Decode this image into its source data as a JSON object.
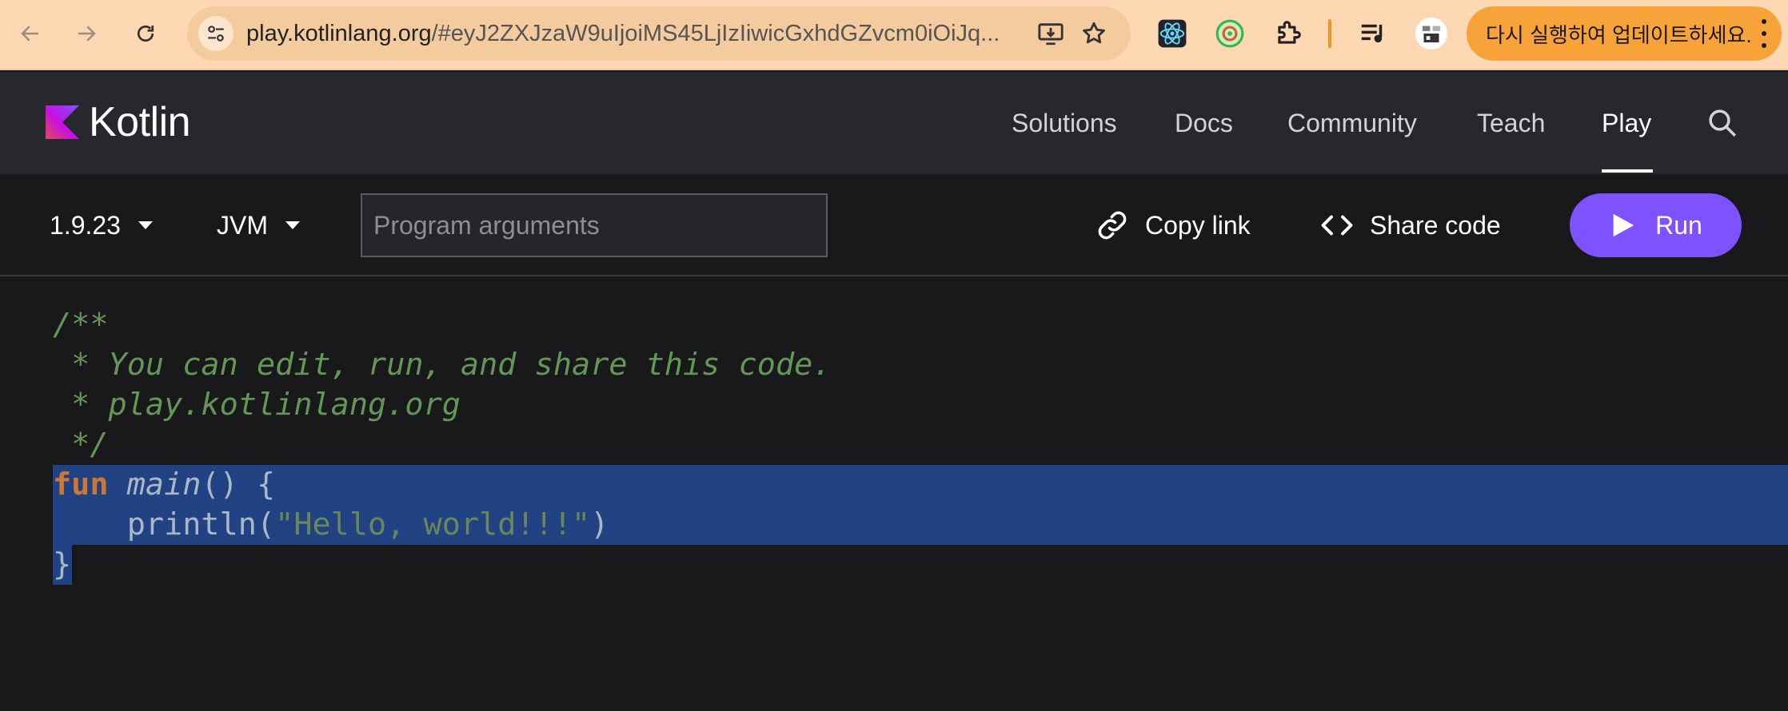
{
  "browser": {
    "url_host": "play.kotlinlang.org",
    "url_rest": "/#eyJ2ZXJzaW9uIjoiMS45LjIzIiwicGxhdGZvcm0iOiJq...",
    "update_label": "다시 실행하여 업데이트하세요.",
    "icons": [
      "back-arrow-icon",
      "forward-arrow-icon",
      "reload-icon",
      "site-settings-icon",
      "install-app-icon",
      "bookmark-star-icon",
      "react-devtools-icon",
      "extension-green-icon",
      "extensions-puzzle-icon",
      "media-queue-icon",
      "profile-avatar-icon",
      "more-vert-icon"
    ]
  },
  "site": {
    "logo_text": "Kotlin",
    "nav": [
      "Solutions",
      "Docs",
      "Community",
      "Teach",
      "Play"
    ],
    "active_nav": "Play"
  },
  "toolbar": {
    "version": "1.9.23",
    "platform": "JVM",
    "args_placeholder": "Program arguments",
    "copy_link": "Copy link",
    "share_code": "Share code",
    "run": "Run",
    "run_color": "#7f52ff"
  },
  "editor": {
    "lines": [
      [
        {
          "t": "/**",
          "c": "comment"
        }
      ],
      [
        {
          "t": " * You can edit, run, and share this code.",
          "c": "comment"
        }
      ],
      [
        {
          "t": " * play.kotlinlang.org",
          "c": "comment"
        }
      ],
      [
        {
          "t": " */",
          "c": "comment"
        }
      ],
      [
        {
          "t": "fun",
          "c": "kw"
        },
        {
          "t": " ",
          "c": "plain"
        },
        {
          "t": "main",
          "c": "fn"
        },
        {
          "t": "() {",
          "c": "plain"
        }
      ],
      [
        {
          "t": "    println(",
          "c": "plain"
        },
        {
          "t": "\"Hello, world!!!\"",
          "c": "str"
        },
        {
          "t": ")",
          "c": "plain"
        }
      ],
      [
        {
          "t": "}",
          "c": "plain"
        }
      ]
    ],
    "selected_lines": [
      4,
      5,
      6
    ],
    "selection_color": "#214283"
  }
}
